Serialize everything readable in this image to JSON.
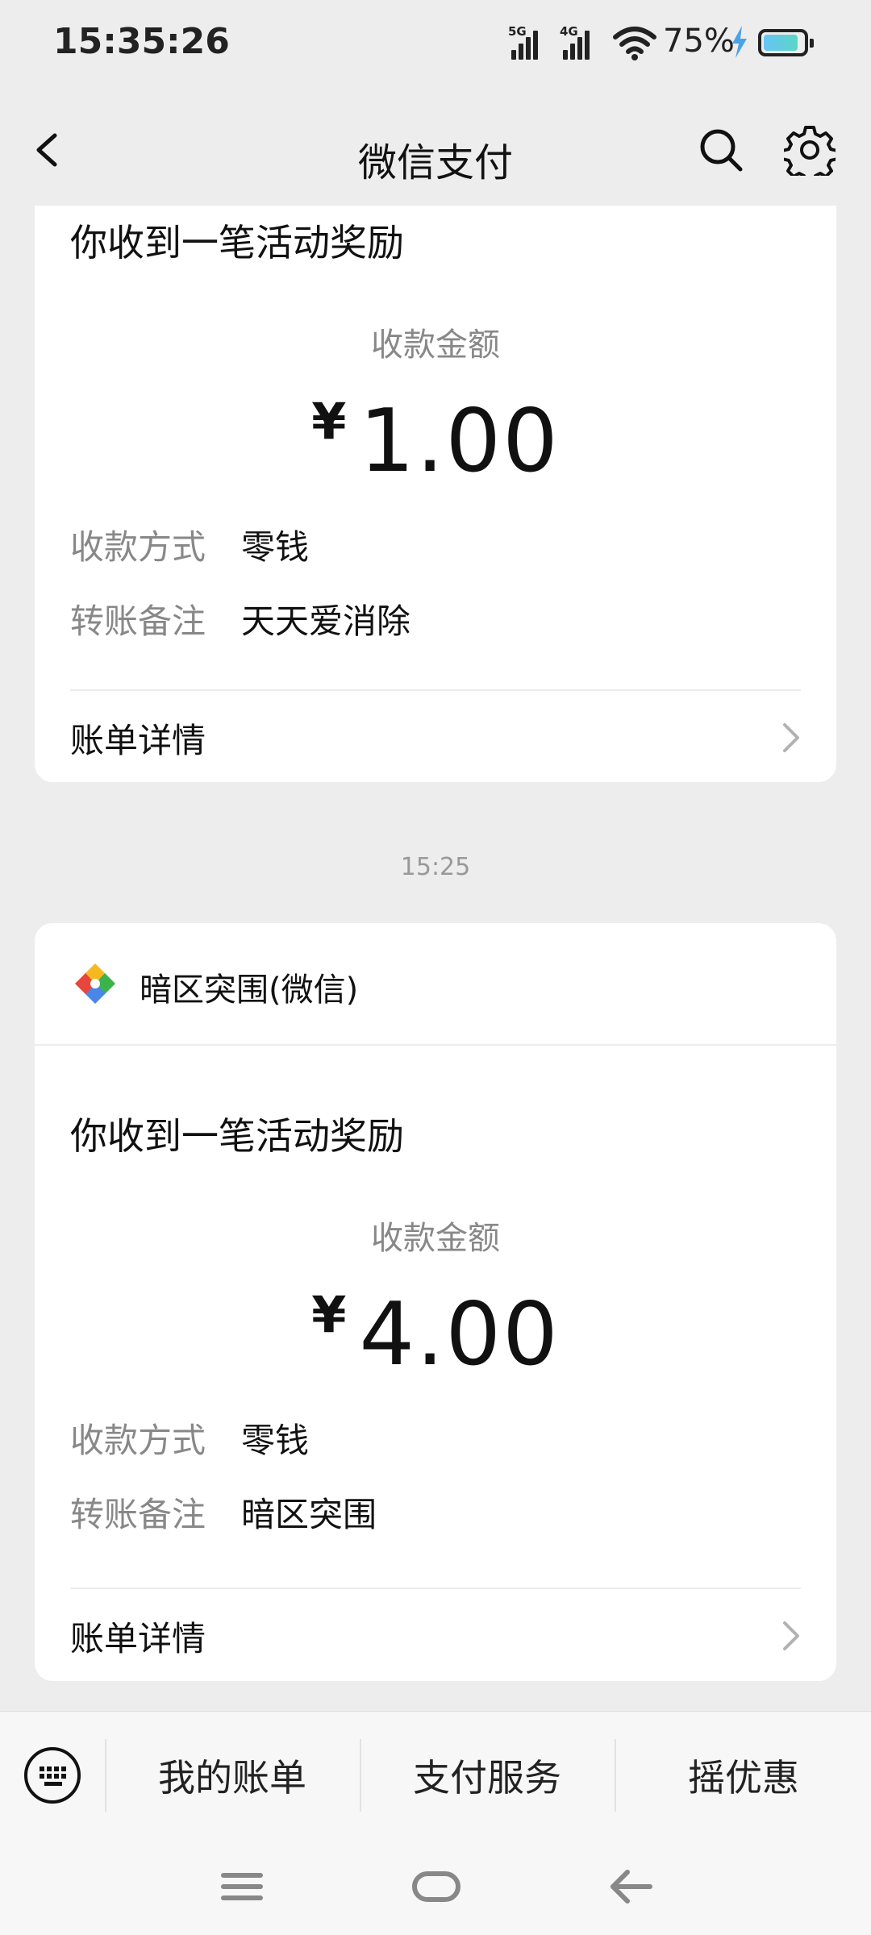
{
  "status_bar": {
    "time": "15:35:26",
    "signal1_gen": "5G",
    "signal2_gen": "4G",
    "battery_percent": "75%"
  },
  "header": {
    "title": "微信支付",
    "back_icon": "chevron-left-icon",
    "search_icon": "search-icon",
    "settings_icon": "gear-icon"
  },
  "card1": {
    "title": "你收到一笔活动奖励",
    "amount_label": "收款金额",
    "currency": "¥",
    "amount": "1.00",
    "rows": [
      {
        "label": "收款方式",
        "value": "零钱"
      },
      {
        "label": "转账备注",
        "value": "天天爱消除"
      }
    ],
    "detail_link": "账单详情"
  },
  "timestamp": "15:25",
  "card2": {
    "sender_name": "暗区突围(微信)",
    "title": "你收到一笔活动奖励",
    "amount_label": "收款金额",
    "currency": "¥",
    "amount": "4.00",
    "rows": [
      {
        "label": "收款方式",
        "value": "零钱"
      },
      {
        "label": "转账备注",
        "value": "暗区突围"
      }
    ],
    "detail_link": "账单详情"
  },
  "bottom_menu": {
    "keyboard_icon": "keyboard-icon",
    "items": [
      "我的账单",
      "支付服务",
      "摇优惠"
    ]
  },
  "nav_bar": {
    "icons": [
      "menu-icon",
      "home-icon",
      "back-icon"
    ]
  },
  "colors": {
    "background": "#ededed",
    "card": "#ffffff",
    "secondary_text": "#888888"
  }
}
